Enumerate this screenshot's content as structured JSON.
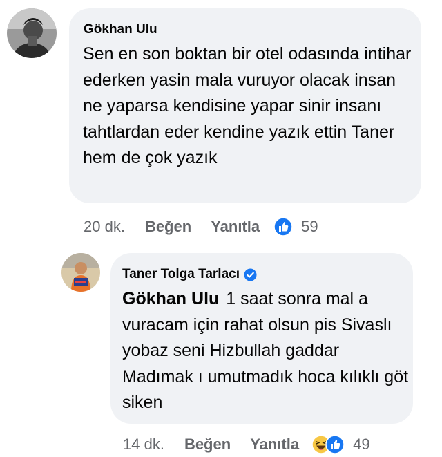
{
  "comment": {
    "author": "Gökhan Ulu",
    "text": "Sen en son boktan bir otel odasında intihar ederken yasin mala vuruyor olacak insan ne yaparsa kendisine yapar sinir insanı tahtlardan eder kendine yazık ettin Taner hem de çok yazık",
    "time": "20 dk.",
    "like_label": "Beğen",
    "reply_label": "Yanıtla",
    "reaction_count": "59",
    "reaction_icons": [
      "like-icon"
    ]
  },
  "reply": {
    "author": "Taner Tolga Tarlacı",
    "verified": true,
    "mention": "Gökhan Ulu",
    "text": "1 saat sonra mal a vuracam için rahat olsun pis Sivaslı yobaz seni Hizbullah gaddar Madımak ı umutmadık hoca kılıklı göt siken",
    "time": "14 dk.",
    "like_label": "Beğen",
    "reply_label": "Yanıtla",
    "reaction_count": "49",
    "reaction_icons": [
      "haha-icon",
      "like-icon"
    ]
  },
  "colors": {
    "bubble": "#f0f2f5",
    "meta_text": "#65676b",
    "like_blue": "#1877f2",
    "verified_blue": "#1877f2",
    "haha_yellow": "#f7c744"
  }
}
